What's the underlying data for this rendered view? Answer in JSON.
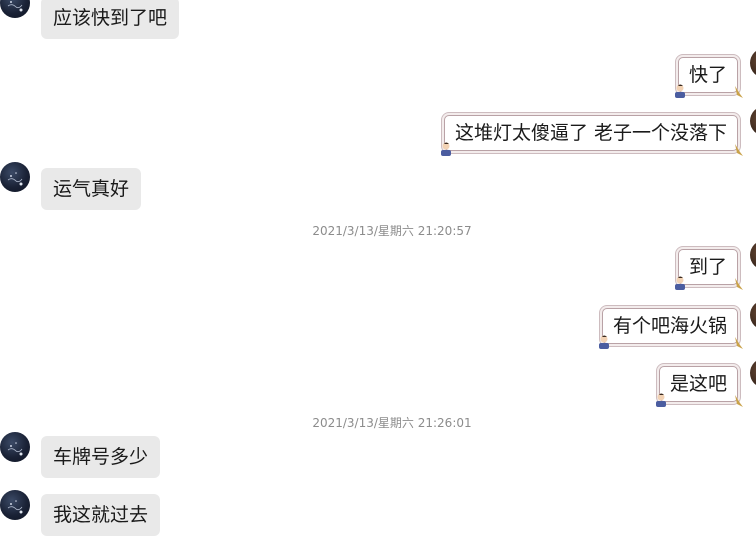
{
  "messages": [
    {
      "side": "in",
      "text": "应该快到了吧"
    },
    {
      "side": "out",
      "text": "快了"
    },
    {
      "side": "out",
      "text": "这堆灯太傻逼了  老子一个没落下"
    },
    {
      "side": "in",
      "text": "运气真好"
    },
    {
      "side": "time",
      "text": "2021/3/13/星期六 21:20:57"
    },
    {
      "side": "out",
      "text": "到了"
    },
    {
      "side": "out",
      "text": "有个吧海火锅"
    },
    {
      "side": "out",
      "text": "是这吧"
    },
    {
      "side": "time",
      "text": "2021/3/13/星期六 21:26:01"
    },
    {
      "side": "in",
      "text": "车牌号多少"
    },
    {
      "side": "in",
      "text": "我这就过去"
    }
  ],
  "colors": {
    "incoming_bubble": "#e9e9e9",
    "outgoing_border": "#b9a2a6",
    "timestamp_text": "#8c8c8c"
  },
  "icons": {
    "contact_avatar": "contact-avatar-icon",
    "self_avatar": "self-avatar-icon",
    "bubble_user_badge": "user-badge-icon",
    "bubble_tail": "bubble-tail-icon"
  }
}
